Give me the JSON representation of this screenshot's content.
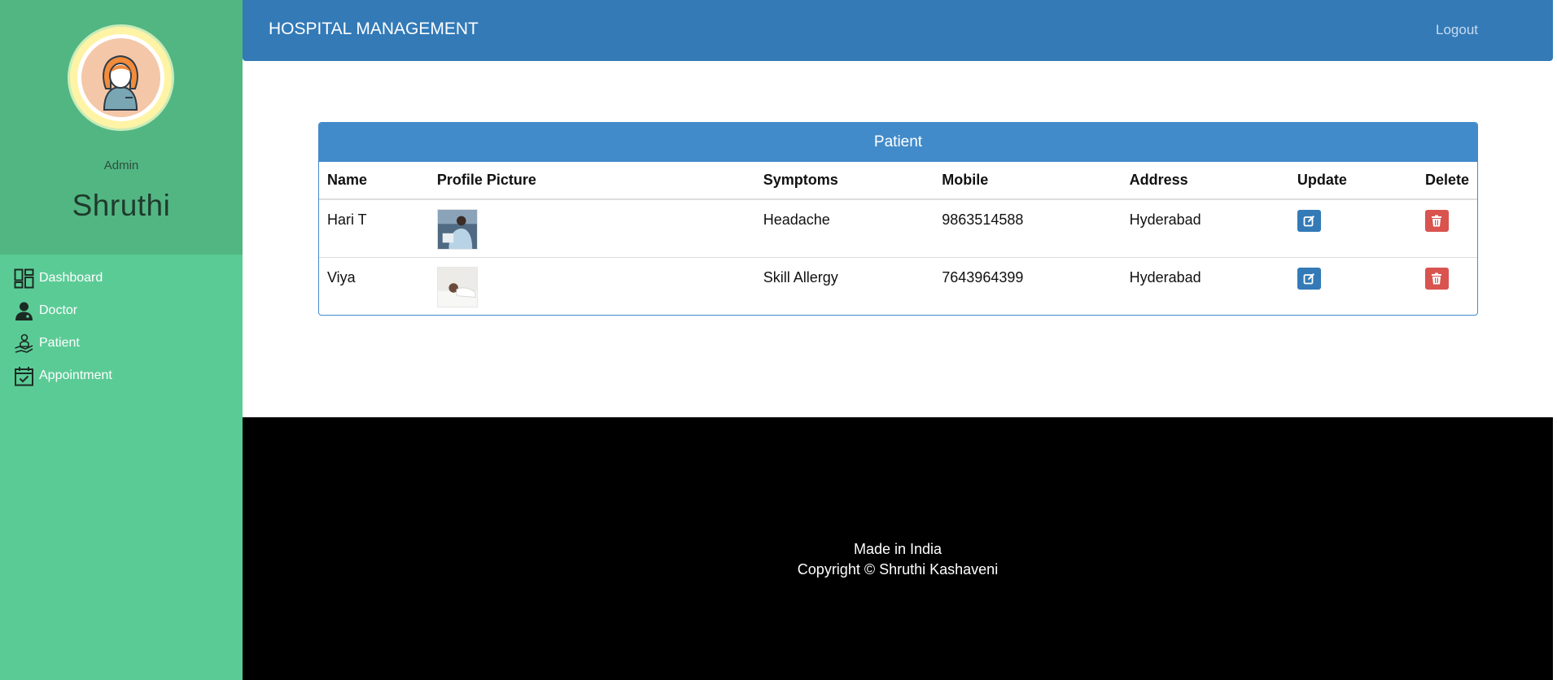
{
  "header": {
    "brand": "HOSPITAL MANAGEMENT",
    "logout": "Logout"
  },
  "sidebar": {
    "role": "Admin",
    "user_name": "Shruthi",
    "items": [
      {
        "label": "Dashboard",
        "icon": "dashboard-icon"
      },
      {
        "label": "Doctor",
        "icon": "doctor-icon"
      },
      {
        "label": "Patient",
        "icon": "patient-icon"
      },
      {
        "label": "Appointment",
        "icon": "calendar-check-icon"
      }
    ]
  },
  "panel": {
    "title": "Patient",
    "columns": [
      "Name",
      "Profile Picture",
      "Symptoms",
      "Mobile",
      "Address",
      "Update",
      "Delete"
    ],
    "rows": [
      {
        "name": "Hari T",
        "symptoms": "Headache",
        "mobile": "9863514588",
        "address": "Hyderabad"
      },
      {
        "name": "Viya",
        "symptoms": "Skill Allergy",
        "mobile": "7643964399",
        "address": "Hyderabad"
      }
    ]
  },
  "footer": {
    "line1": "Made in India",
    "line2": "Copyright © Shruthi Kashaveni"
  },
  "colors": {
    "sidebar": "#5bcb96",
    "sidebar_profile": "#52b683",
    "header": "#337ab7",
    "panel_head": "#428bca",
    "delete": "#d9534f",
    "footer": "#000000"
  }
}
